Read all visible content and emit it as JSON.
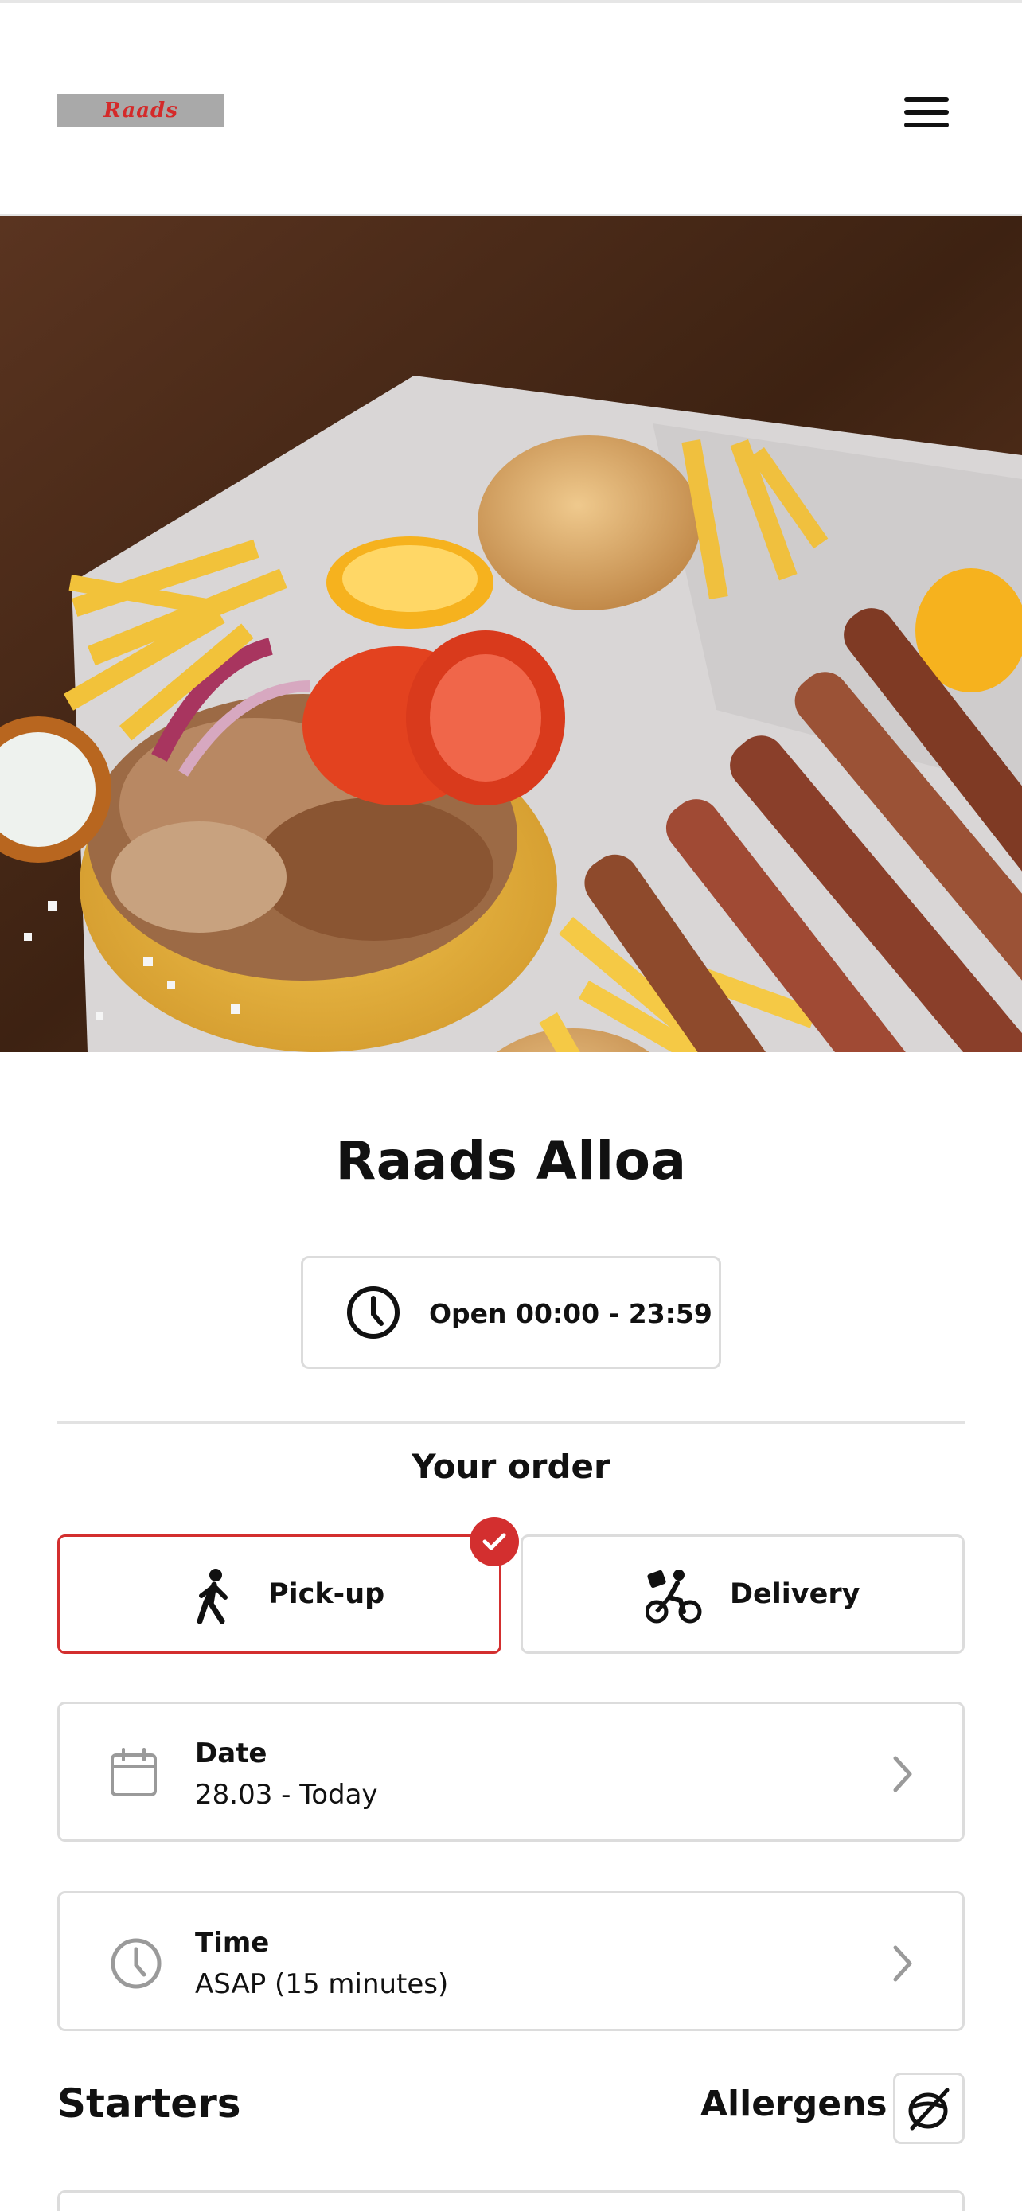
{
  "header": {
    "logo_text": "Raads",
    "menu_icon": "hamburger-menu-icon"
  },
  "hero": {
    "image_description_icon": "food-photo"
  },
  "restaurant": {
    "name": "Raads Alloa",
    "hours": "Open 00:00 - 23:59",
    "hours_icon": "clock-icon"
  },
  "order": {
    "title": "Your order",
    "options": [
      {
        "label": "Pick-up",
        "icon": "walking-person-icon",
        "selected": true
      },
      {
        "label": "Delivery",
        "icon": "bicycle-courier-icon",
        "selected": false
      }
    ],
    "date": {
      "label": "Date",
      "value": "28.03 - Today",
      "icon": "calendar-icon"
    },
    "time": {
      "label": "Time",
      "value": "ASAP (15 minutes)",
      "icon": "clock-icon"
    }
  },
  "menu": {
    "section_title": "Starters",
    "allergens_label": "Allergens",
    "allergens_icon": "allergen-nut-icon"
  },
  "colors": {
    "accent": "#d32f2f",
    "border": "#dcdcdc",
    "text": "#111111"
  }
}
